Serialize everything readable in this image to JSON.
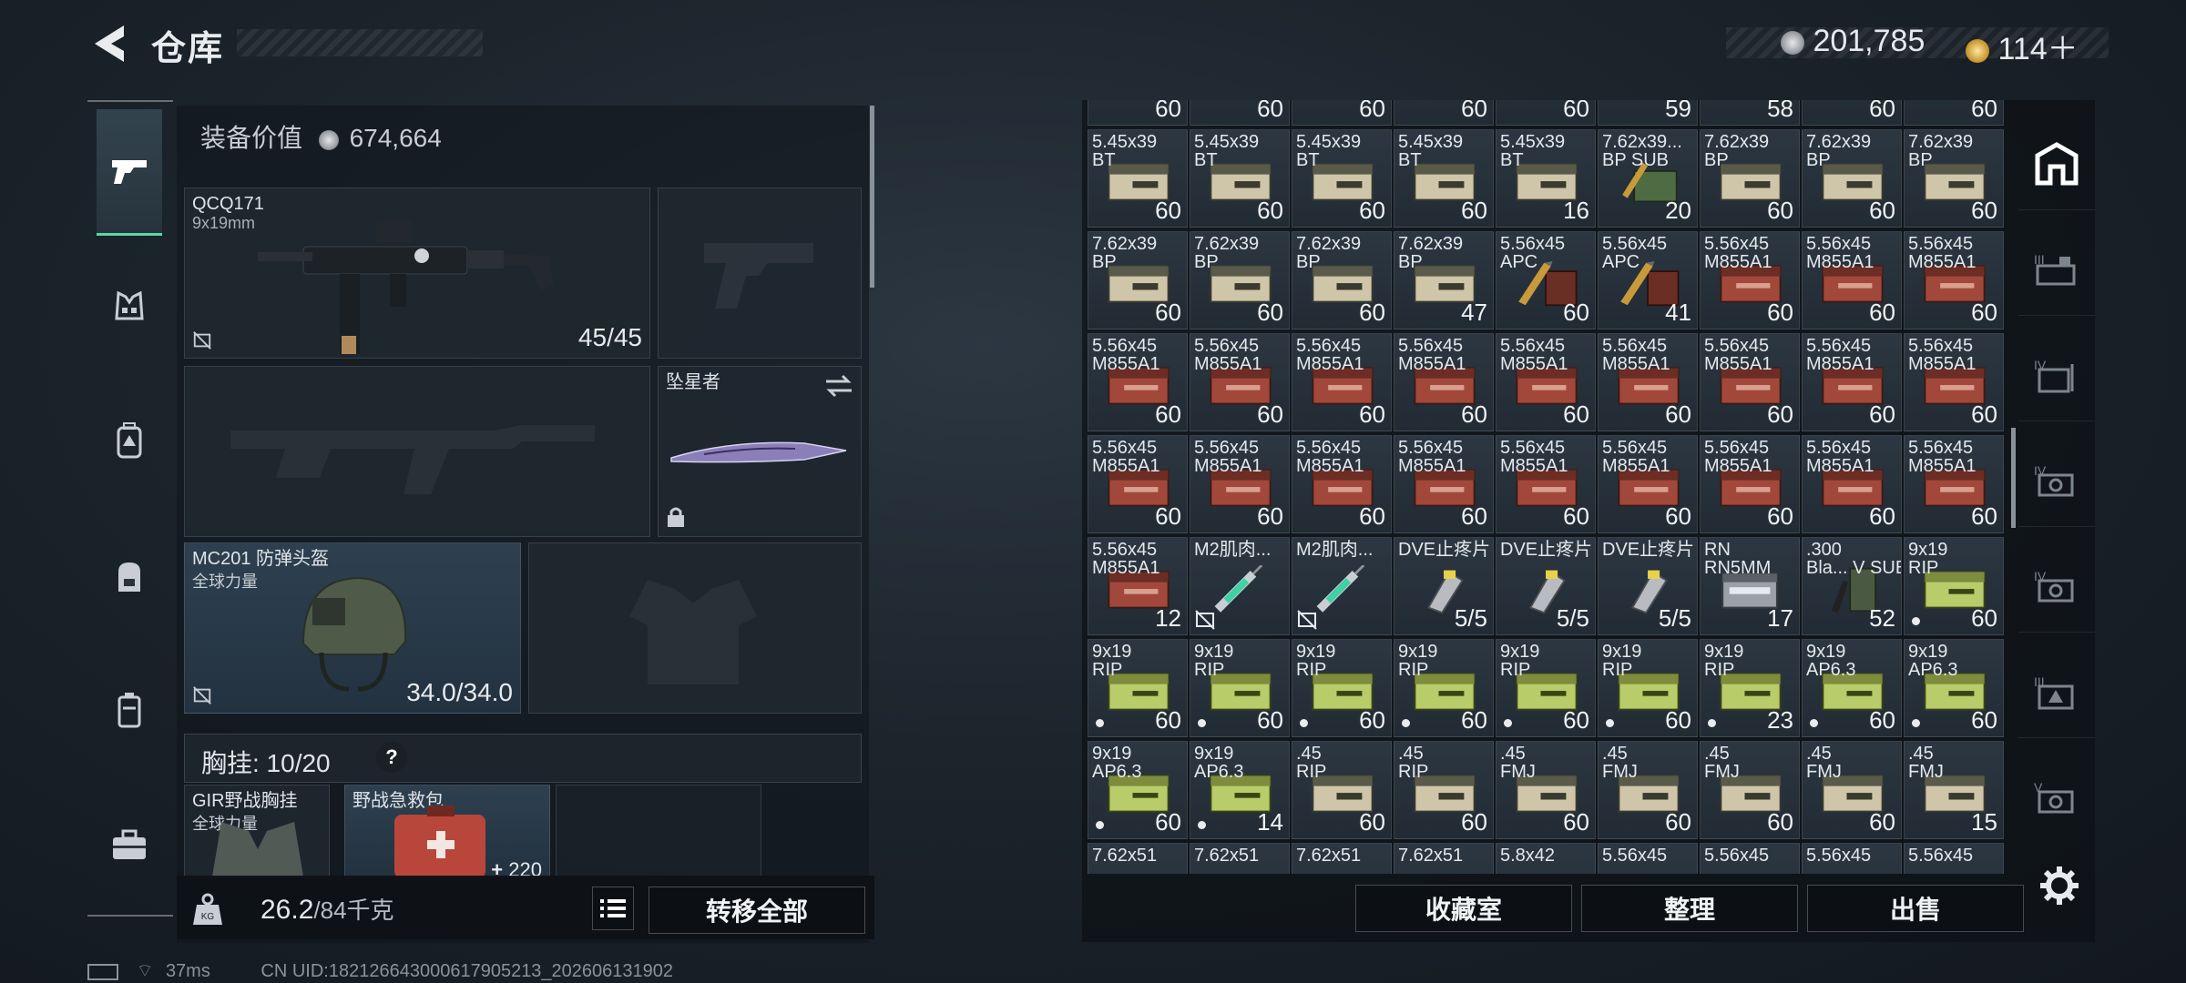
{
  "header": {
    "title": "仓库",
    "currency1": "201,785",
    "currency2": "114＋"
  },
  "equipment_value": {
    "label": "装备价值",
    "value": "674,664"
  },
  "slots": {
    "primary": {
      "name": "QCQ171",
      "caliber": "9x19mm",
      "ammo": "45/45"
    },
    "melee": {
      "name": "坠星者"
    },
    "helmet": {
      "name": "MC201 防弹头盔",
      "brand": "全球力量",
      "durability": "34.0/34.0"
    },
    "chest_rig": {
      "label": "胸挂: 10/20"
    },
    "rig_item": {
      "name": "GIR野战胸挂",
      "brand": "全球力量"
    },
    "medkit": {
      "name": "野战急救包",
      "count": "220"
    }
  },
  "weight": {
    "current": "26.2",
    "max": "/84千克"
  },
  "buttons": {
    "transfer_all": "转移全部",
    "collection": "收藏室",
    "organize": "整理",
    "sell": "出售"
  },
  "footer": {
    "ping": "37ms",
    "uid": "CN UID:182126643000617905213_202606131902"
  },
  "partial_top_counts": [
    "60",
    "60",
    "60",
    "60",
    "60",
    "59",
    "58",
    "60",
    "60"
  ],
  "partial_bottom_labels": [
    "7.62x51",
    "7.62x51",
    "7.62x51",
    "7.62x51",
    "5.8x42",
    "5.56x45",
    "5.56x45",
    "5.56x45",
    "5.56x45"
  ],
  "grid": [
    [
      {
        "n": "5.45x39 BT",
        "c": "60",
        "t": "tan"
      },
      {
        "n": "5.45x39 BT",
        "c": "60",
        "t": "tan"
      },
      {
        "n": "5.45x39 BT",
        "c": "60",
        "t": "tan"
      },
      {
        "n": "5.45x39 BT",
        "c": "60",
        "t": "tan"
      },
      {
        "n": "5.45x39 BT",
        "c": "16",
        "t": "tan"
      },
      {
        "n": "7.62x39... BP SUB",
        "c": "20",
        "t": "green"
      },
      {
        "n": "7.62x39 BP",
        "c": "60",
        "t": "tan"
      },
      {
        "n": "7.62x39 BP",
        "c": "60",
        "t": "tan"
      },
      {
        "n": "7.62x39 BP",
        "c": "60",
        "t": "tan"
      }
    ],
    [
      {
        "n": "7.62x39 BP",
        "c": "60",
        "t": "tan"
      },
      {
        "n": "7.62x39 BP",
        "c": "60",
        "t": "tan"
      },
      {
        "n": "7.62x39 BP",
        "c": "60",
        "t": "tan"
      },
      {
        "n": "7.62x39 BP",
        "c": "47",
        "t": "tan"
      },
      {
        "n": "5.56x45 APC",
        "c": "60",
        "t": "bullet"
      },
      {
        "n": "5.56x45 APC",
        "c": "41",
        "t": "bullet"
      },
      {
        "n": "5.56x45 M855A1",
        "c": "60",
        "t": "red"
      },
      {
        "n": "5.56x45 M855A1",
        "c": "60",
        "t": "red"
      },
      {
        "n": "5.56x45 M855A1",
        "c": "60",
        "t": "red"
      }
    ],
    [
      {
        "n": "5.56x45 M855A1",
        "c": "60",
        "t": "red"
      },
      {
        "n": "5.56x45 M855A1",
        "c": "60",
        "t": "red"
      },
      {
        "n": "5.56x45 M855A1",
        "c": "60",
        "t": "red"
      },
      {
        "n": "5.56x45 M855A1",
        "c": "60",
        "t": "red"
      },
      {
        "n": "5.56x45 M855A1",
        "c": "60",
        "t": "red"
      },
      {
        "n": "5.56x45 M855A1",
        "c": "60",
        "t": "red"
      },
      {
        "n": "5.56x45 M855A1",
        "c": "60",
        "t": "red"
      },
      {
        "n": "5.56x45 M855A1",
        "c": "60",
        "t": "red"
      },
      {
        "n": "5.56x45 M855A1",
        "c": "60",
        "t": "red"
      }
    ],
    [
      {
        "n": "5.56x45 M855A1",
        "c": "60",
        "t": "red"
      },
      {
        "n": "5.56x45 M855A1",
        "c": "60",
        "t": "red"
      },
      {
        "n": "5.56x45 M855A1",
        "c": "60",
        "t": "red"
      },
      {
        "n": "5.56x45 M855A1",
        "c": "60",
        "t": "red"
      },
      {
        "n": "5.56x45 M855A1",
        "c": "60",
        "t": "red"
      },
      {
        "n": "5.56x45 M855A1",
        "c": "60",
        "t": "red"
      },
      {
        "n": "5.56x45 M855A1",
        "c": "60",
        "t": "red"
      },
      {
        "n": "5.56x45 M855A1",
        "c": "60",
        "t": "red"
      },
      {
        "n": "5.56x45 M855A1",
        "c": "60",
        "t": "red"
      }
    ],
    [
      {
        "n": "5.56x45 M855A1",
        "c": "12",
        "t": "red"
      },
      {
        "n": "M2肌肉...",
        "c": "",
        "t": "syringe",
        "ni": true
      },
      {
        "n": "M2肌肉...",
        "c": "",
        "t": "syringe",
        "ni": true
      },
      {
        "n": "DVE止疼片",
        "c": "5/5",
        "t": "pill"
      },
      {
        "n": "DVE止疼片",
        "c": "5/5",
        "t": "pill"
      },
      {
        "n": "DVE止疼片",
        "c": "5/5",
        "t": "pill"
      },
      {
        "n": "RN RN5MM",
        "c": "17",
        "t": "gray"
      },
      {
        "n": ".300 Bla... V SUB",
        "c": "52",
        "t": "mag"
      },
      {
        "n": "9x19 RIP",
        "c": "60",
        "t": "lime",
        "dot": true
      }
    ],
    [
      {
        "n": "9x19 RIP",
        "c": "60",
        "t": "lime",
        "dot": true
      },
      {
        "n": "9x19 RIP",
        "c": "60",
        "t": "lime",
        "dot": true
      },
      {
        "n": "9x19 RIP",
        "c": "60",
        "t": "lime",
        "dot": true
      },
      {
        "n": "9x19 RIP",
        "c": "60",
        "t": "lime",
        "dot": true
      },
      {
        "n": "9x19 RIP",
        "c": "60",
        "t": "lime",
        "dot": true
      },
      {
        "n": "9x19 RIP",
        "c": "60",
        "t": "lime",
        "dot": true
      },
      {
        "n": "9x19 RIP",
        "c": "23",
        "t": "lime",
        "dot": true
      },
      {
        "n": "9x19 AP6.3",
        "c": "60",
        "t": "lime",
        "dot": true
      },
      {
        "n": "9x19 AP6.3",
        "c": "60",
        "t": "lime",
        "dot": true
      }
    ],
    [
      {
        "n": "9x19 AP6.3",
        "c": "60",
        "t": "lime",
        "dot": true
      },
      {
        "n": "9x19 AP6.3",
        "c": "14",
        "t": "lime",
        "dot": true
      },
      {
        "n": ".45 RIP",
        "c": "60",
        "t": "tan"
      },
      {
        "n": ".45 RIP",
        "c": "60",
        "t": "tan"
      },
      {
        "n": ".45 FMJ",
        "c": "60",
        "t": "tan"
      },
      {
        "n": ".45 FMJ",
        "c": "60",
        "t": "tan"
      },
      {
        "n": ".45 FMJ",
        "c": "60",
        "t": "tan"
      },
      {
        "n": ".45 FMJ",
        "c": "60",
        "t": "tan"
      },
      {
        "n": ".45 FMJ",
        "c": "15",
        "t": "tan"
      }
    ]
  ],
  "colors": {
    "accent": "#5fd6a4",
    "panel": "#1c242c"
  }
}
